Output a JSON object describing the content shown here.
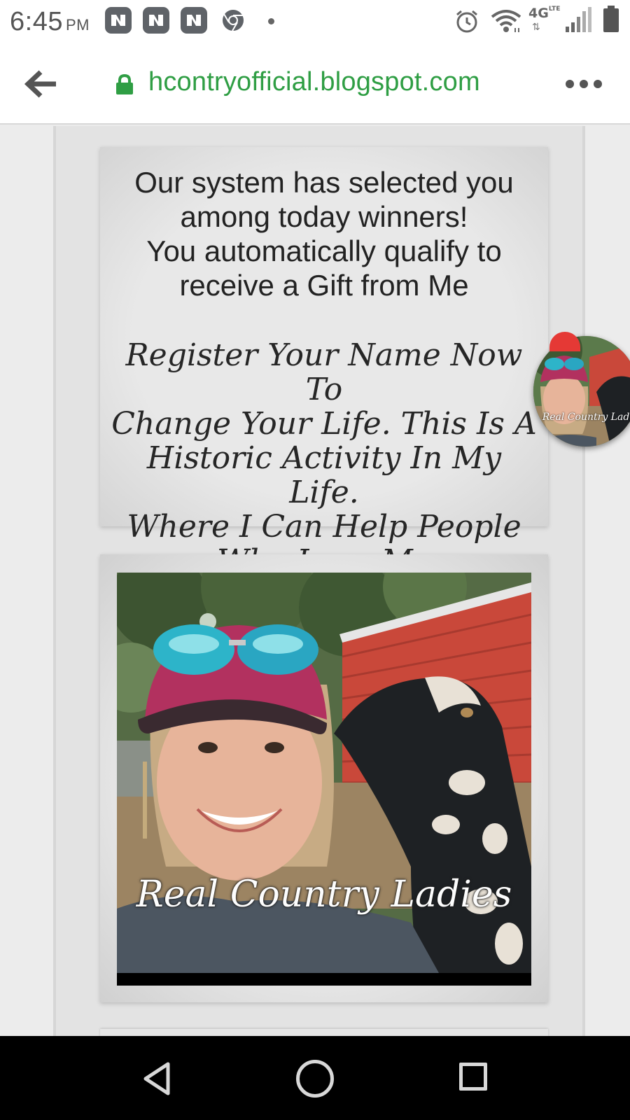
{
  "status_bar": {
    "time": "6:45",
    "ampm": "PM",
    "network": "4G",
    "network_sub": "LTE",
    "icons": [
      "news-app-icon",
      "news-app-icon",
      "news-app-icon",
      "chrome-icon",
      "dot-icon",
      "alarm-icon",
      "wifi-icon",
      "signal-icon",
      "battery-icon"
    ]
  },
  "browser": {
    "url": "hcontryofficial.blogspot.com",
    "accent_color": "#2f9e44"
  },
  "page": {
    "headline_lines": [
      "Our system has selected you",
      "among today winners!",
      "You automatically qualify to",
      "receive a Gift from Me"
    ],
    "subtext_lines": [
      "Register Your Name Now To",
      "Change Your Life. This Is A",
      "Historic Activity In My Life.",
      "Where I Can Help People",
      "Who Love Me"
    ],
    "photo_caption": "Real Country Ladies",
    "avatar_caption": "Real Country Ladies"
  },
  "nav": {
    "buttons": [
      "back-triangle",
      "home-circle",
      "recents-square"
    ]
  }
}
